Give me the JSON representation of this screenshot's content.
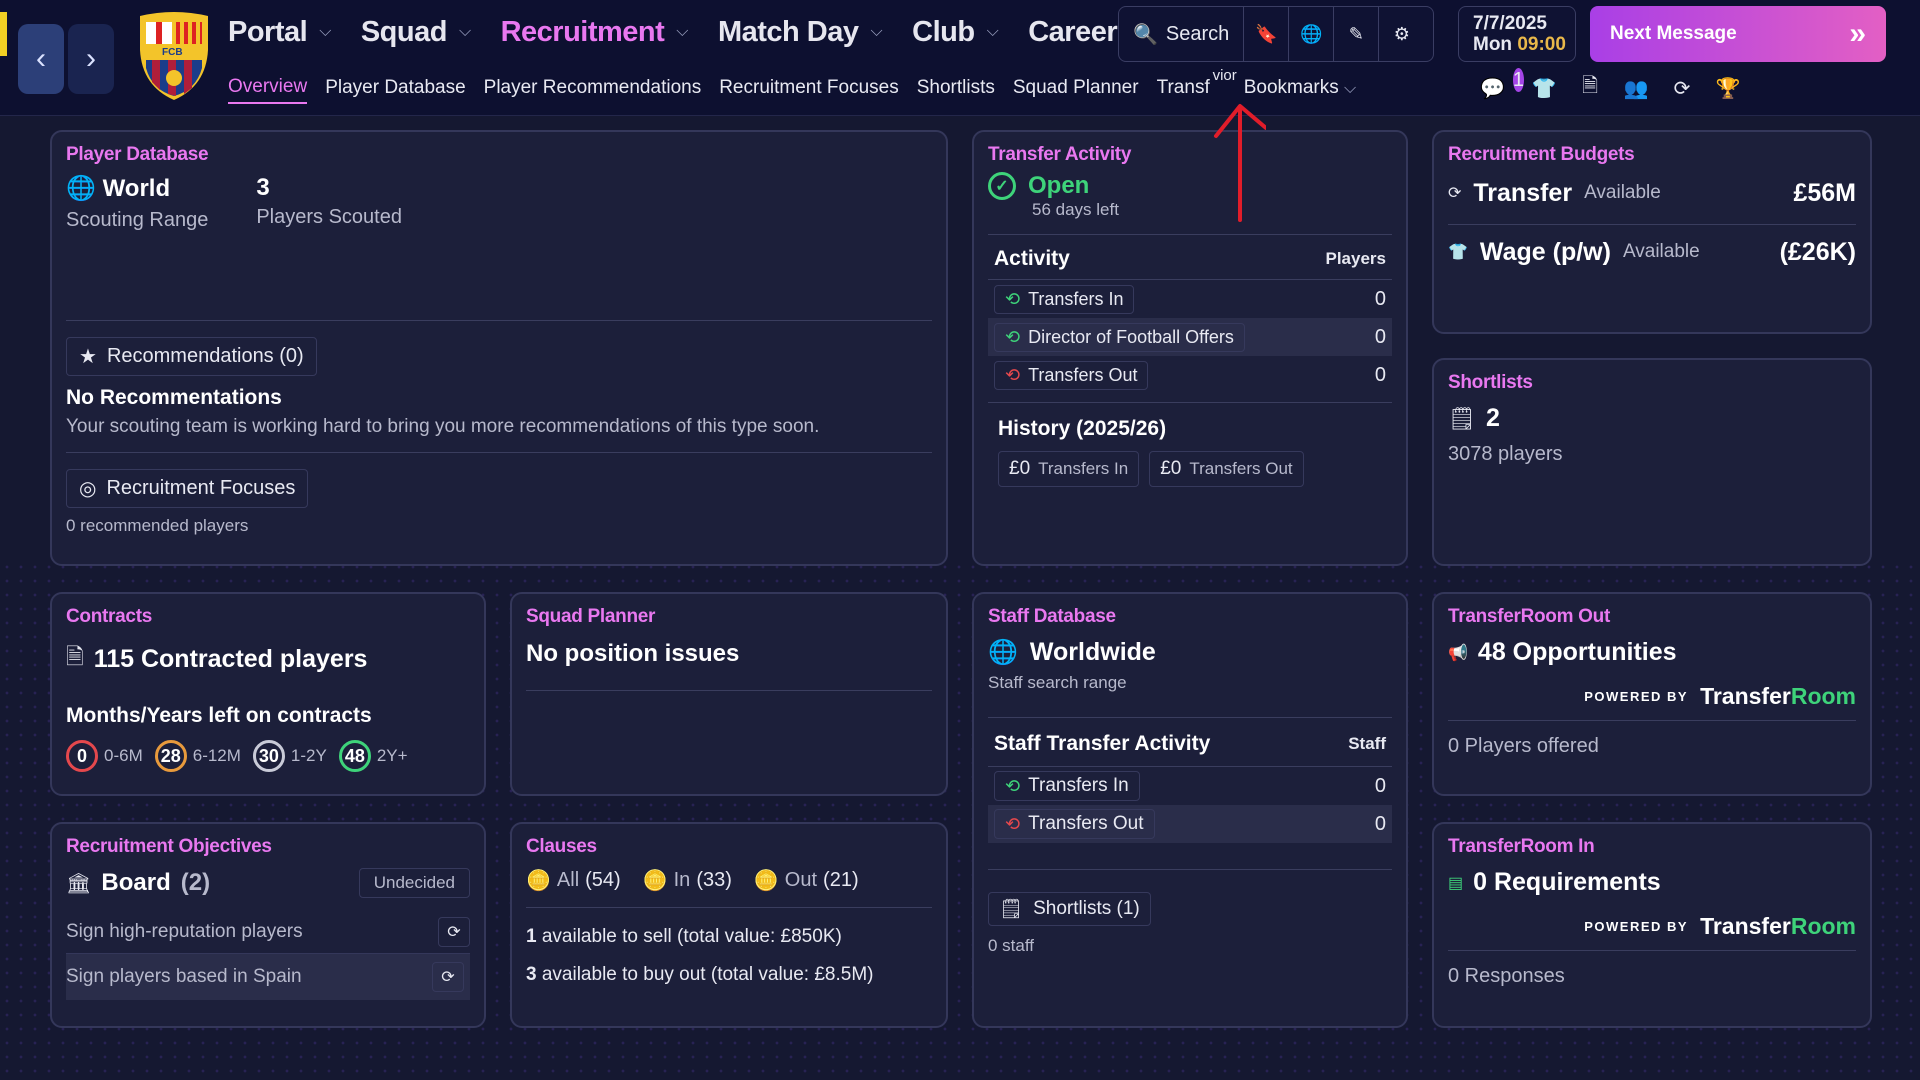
{
  "header": {
    "nav_back": "‹",
    "nav_forward": "›",
    "menu": [
      {
        "label": "Portal"
      },
      {
        "label": "Squad"
      },
      {
        "label": "Recruitment"
      },
      {
        "label": "Match Day"
      },
      {
        "label": "Club"
      },
      {
        "label": "Career"
      }
    ],
    "tabs": [
      {
        "label": "Overview"
      },
      {
        "label": "Player Database"
      },
      {
        "label": "Player Recommendations"
      },
      {
        "label": "Recruitment Focuses"
      },
      {
        "label": "Shortlists"
      },
      {
        "label": "Squad Planner"
      },
      {
        "label": "Transf"
      },
      {
        "label": "Bookmarks"
      }
    ],
    "tab_overflow": "vior",
    "search": "Search",
    "date": "7/7/2025",
    "day": "Mon",
    "time": "09:00",
    "next_message": "Next Message",
    "chat_badge": "1",
    "crest_text": "FCB"
  },
  "player_database": {
    "title": "Player Database",
    "range_value": "World",
    "range_label": "Scouting Range",
    "scouted_value": "3",
    "scouted_label": "Players Scouted",
    "recommendations": "Recommendations (0)",
    "no_rec_title": "No Recommentations",
    "no_rec_text": "Your scouting team is working hard to bring you more recommendations of this type soon.",
    "focuses": "Recruitment Focuses",
    "focuses_sub": "0 recommended players"
  },
  "transfer_activity": {
    "title": "Transfer Activity",
    "status": "Open",
    "days_left": "56 days left",
    "activity_label": "Activity",
    "players_label": "Players",
    "rows": [
      {
        "label": "Transfers In",
        "value": "0"
      },
      {
        "label": "Director of Football Offers",
        "value": "0"
      },
      {
        "label": "Transfers Out",
        "value": "0"
      }
    ],
    "history_title": "History (2025/26)",
    "hist_in_value": "£0",
    "hist_in_label": "Transfers In",
    "hist_out_value": "£0",
    "hist_out_label": "Transfers Out"
  },
  "budgets": {
    "title": "Recruitment Budgets",
    "transfer_label": "Transfer",
    "transfer_avail": "Available",
    "transfer_value": "£56M",
    "wage_label": "Wage (p/w)",
    "wage_avail": "Available",
    "wage_value": "(£26K)"
  },
  "shortlists": {
    "title": "Shortlists",
    "count": "2",
    "players": "3078 players"
  },
  "contracts": {
    "title": "Contracts",
    "headline": "115 Contracted players",
    "sub": "Months/Years left on contracts",
    "buckets": [
      {
        "value": "0",
        "label": "0-6M",
        "color": "#e5484d"
      },
      {
        "value": "28",
        "label": "6-12M",
        "color": "#e89a3c"
      },
      {
        "value": "30",
        "label": "1-2Y",
        "color": "#c9cbd8"
      },
      {
        "value": "48",
        "label": "2Y+",
        "color": "#3ed37a"
      }
    ]
  },
  "squad_planner": {
    "title": "Squad Planner",
    "text": "No position issues"
  },
  "staff_database": {
    "title": "Staff Database",
    "range_value": "Worldwide",
    "range_label": "Staff search range",
    "activity_label": "Staff Transfer Activity",
    "staff_label": "Staff",
    "rows": [
      {
        "label": "Transfers In",
        "value": "0"
      },
      {
        "label": "Transfers Out",
        "value": "0"
      }
    ],
    "shortlists": "Shortlists (1)",
    "shortlists_sub": "0 staff"
  },
  "transferroom_out": {
    "title": "TransferRoom Out",
    "headline": "48 Opportunities",
    "powered": "POWERED BY",
    "brand_a": "Transfer",
    "brand_b": "Room",
    "sub": "0 Players offered"
  },
  "objectives": {
    "title": "Recruitment Objectives",
    "board": "Board",
    "board_count": "(2)",
    "status": "Undecided",
    "items": [
      {
        "label": "Sign high-reputation players"
      },
      {
        "label": "Sign players based in Spain"
      }
    ]
  },
  "clauses": {
    "title": "Clauses",
    "all": "All",
    "all_count": "(54)",
    "in": "In",
    "in_count": "(33)",
    "out": "Out",
    "out_count": "(21)",
    "line1_count": "1",
    "line1_text": "available to sell (total value: £850K)",
    "line2_count": "3",
    "line2_text": "available to buy out (total value: £8.5M)"
  },
  "transferroom_in": {
    "title": "TransferRoom In",
    "headline": "0 Requirements",
    "powered": "POWERED BY",
    "brand_a": "Transfer",
    "brand_b": "Room",
    "sub": "0 Responses"
  }
}
